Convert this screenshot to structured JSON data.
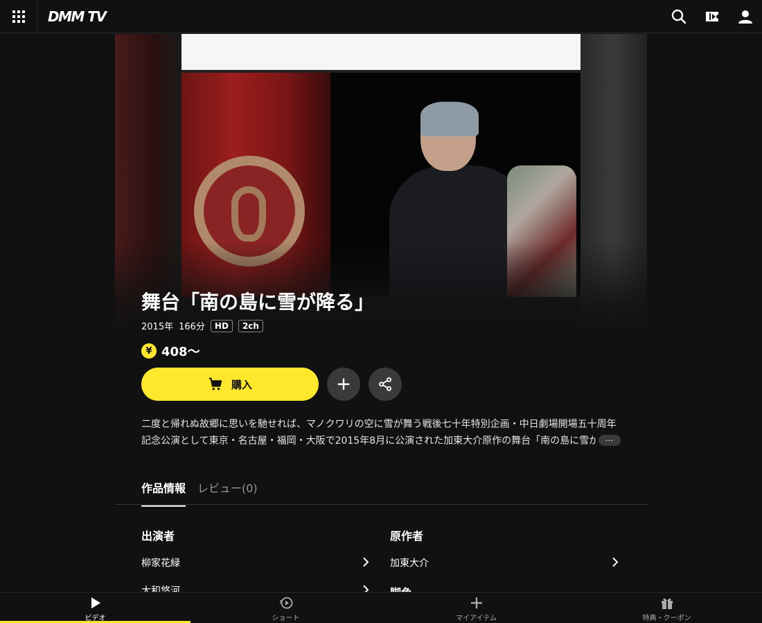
{
  "header": {
    "logo": "DMM TV",
    "icons": [
      "grid-menu-icon",
      "search-icon",
      "ticket-icon",
      "user-icon"
    ]
  },
  "title": {
    "text": "舞台「南の島に雪が降る」",
    "year": "2015年",
    "duration": "166分",
    "badge_hd": "HD",
    "badge_audio": "2ch"
  },
  "price": {
    "currency_symbol": "¥",
    "text": "408〜"
  },
  "actions": {
    "buy_label": "購入",
    "icons": [
      "cart-icon",
      "plus-icon",
      "share-icon"
    ]
  },
  "description": {
    "line1": "二度と帰れぬ故郷に思いを馳せれば、マノクワリの空に雪が舞う戦後七十年特別企画・中日劇場開場五十周年",
    "line2": "記念公演として東京・名古屋・福岡・大阪で2015年8月に公演された加東大介原作の舞台「南の島に雪が",
    "more_label": "⋯"
  },
  "tabs": {
    "info": "作品情報",
    "review": "レビュー(0)"
  },
  "info": {
    "cast_title": "出演者",
    "cast": [
      "柳家花緑",
      "大和悠河"
    ],
    "author_title": "原作者",
    "author": "加東大介",
    "next_title_partial": "脚色"
  },
  "bottom_nav": {
    "items": [
      {
        "label": "ビデオ",
        "icon": "play-icon"
      },
      {
        "label": "ショート",
        "icon": "short-icon"
      },
      {
        "label": "マイアイテム",
        "icon": "plus-icon"
      },
      {
        "label": "特典・クーポン",
        "icon": "gift-icon"
      }
    ]
  },
  "colors": {
    "accent": "#ffe82c",
    "background": "#111111",
    "button_gray": "#3a3a3a"
  }
}
